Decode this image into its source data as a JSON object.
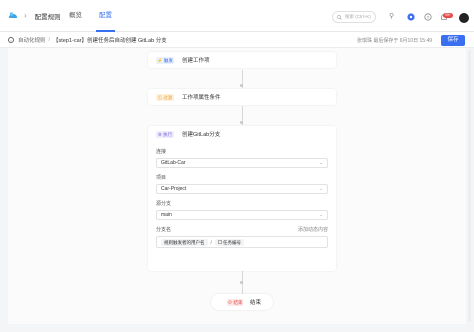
{
  "header": {
    "nav_title": "配置规则",
    "tabs": [
      {
        "label": "概览"
      },
      {
        "label": "配置",
        "active": true
      }
    ],
    "search_placeholder": "搜索 (Ctrl+K)",
    "notification_badge": "99+",
    "accent_color": "#3b6ff2"
  },
  "breadcrumb": {
    "parent": "自动化规则",
    "separator": "/",
    "current": "【step1-car】创建任务后自动创建 GitLab 分支"
  },
  "toolbar": {
    "save_hint": "张琪珠 最后保存于 6月10日 15:49",
    "save_label": "保存"
  },
  "flow": {
    "nodes": [
      {
        "tag": "⚡ 触发",
        "title": "创建工作项"
      },
      {
        "tag": "⚠ 过滤",
        "title": "工作项属性条件"
      },
      {
        "tag": "⚙ 执行",
        "title": "创建GitLab分支"
      }
    ],
    "form": {
      "connection_label": "连接",
      "connection_value": "GitLab-Car",
      "project_label": "项目",
      "project_value": "Car-Project",
      "source_branch_label": "源分支",
      "source_branch_value": "main",
      "branch_name_label": "分支名",
      "add_content_label": "添加动态内容",
      "branch_chip_1": "规则触发者的用户名",
      "branch_separator": "/",
      "branch_chip_2": "任务编号"
    },
    "end": {
      "tag": "⊘ 结束",
      "label": "结束"
    }
  }
}
